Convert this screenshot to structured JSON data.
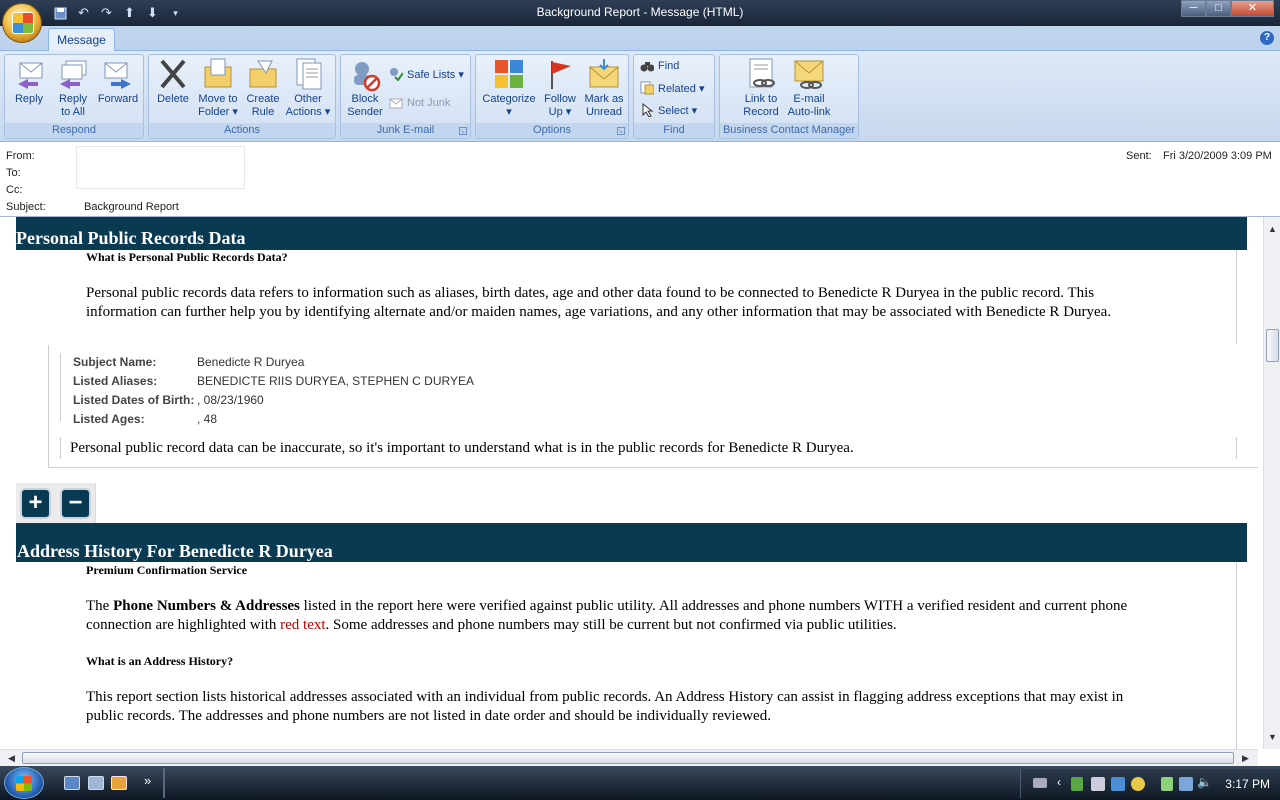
{
  "window": {
    "title": "Background Report - Message (HTML)",
    "controls": {
      "minimize": "─",
      "maximize": "□",
      "close": "✕"
    }
  },
  "ribbon": {
    "tab": "Message",
    "help": "?",
    "groups": {
      "respond": {
        "label": "Respond",
        "reply": "Reply",
        "reply_all": "Reply\nto All",
        "forward": "Forward"
      },
      "actions": {
        "label": "Actions",
        "delete": "Delete",
        "move_to_folder": "Move to\nFolder ▾",
        "create_rule": "Create\nRule",
        "other_actions": "Other\nActions ▾"
      },
      "junk": {
        "label": "Junk E-mail",
        "block_sender": "Block\nSender",
        "safe_lists": "Safe Lists ▾",
        "not_junk": "Not Junk"
      },
      "options": {
        "label": "Options",
        "categorize": "Categorize\n▾",
        "follow_up": "Follow\nUp ▾",
        "mark_unread": "Mark as\nUnread"
      },
      "find": {
        "label": "Find",
        "find": "Find",
        "related": "Related ▾",
        "select": "Select ▾"
      },
      "bcm": {
        "label": "Business Contact Manager",
        "link_to_record": "Link to\nRecord",
        "email_autolink": "E-mail\nAuto-link"
      }
    }
  },
  "header": {
    "from_label": "From:",
    "to_label": "To:",
    "cc_label": "Cc:",
    "subject_label": "Subject:",
    "subject": "Background Report",
    "sent_label": "Sent:",
    "sent": "Fri 3/20/2009 3:09 PM"
  },
  "body": {
    "section1": {
      "title": "Personal Public Records Data",
      "question": "What is Personal Public Records Data?",
      "para_l1": "Personal public records data refers to information such as aliases, birth dates, age and other data found to be connected to Benedicte R Duryea in the public record. This",
      "para_l2": "information can further help you by identifying alternate and/or maiden names, age variations, and any other information that may be associated with Benedicte R Duryea.",
      "rows": [
        {
          "label": "Subject Name:",
          "value": "Benedicte R Duryea"
        },
        {
          "label": "Listed Aliases:",
          "value": "BENEDICTE RIIS DURYEA, STEPHEN C DURYEA"
        },
        {
          "label": "Listed Dates of Birth:",
          "value": ", 08/23/1960"
        },
        {
          "label": "Listed Ages:",
          "value": ", 48"
        }
      ],
      "note": "Personal public record data can be inaccurate, so it's important to understand what is in the public records for Benedicte R Duryea."
    },
    "expand": "+",
    "collapse": "−",
    "section2": {
      "title": "Address History For Benedicte R Duryea",
      "service": "Premium Confirmation Service",
      "p1_pre": "The ",
      "p1_bold": "Phone Numbers & Addresses",
      "p1_post": " listed in the report here were verified against public utility. All addresses and phone numbers WITH a verified resident and current phone",
      "p1_l2_pre": "connection are highlighted with ",
      "p1_red": "red text",
      "p1_l2_post": ". Some addresses and phone numbers may still be current but not confirmed via public utilities.",
      "question": "What is an Address History?",
      "p2_l1": "This report section lists historical addresses associated with an individual from public records. An Address History can assist in flagging address exceptions that may exist in",
      "p2_l2": "public records. The addresses and phone numbers are not listed in date order and should be individually reviewed."
    }
  },
  "taskbar": {
    "clock": "3:17 PM",
    "overflow": "»"
  },
  "colors": {
    "band": "#0a3a52",
    "accent_red": "#c00000",
    "ribbon_text": "#15428b"
  }
}
